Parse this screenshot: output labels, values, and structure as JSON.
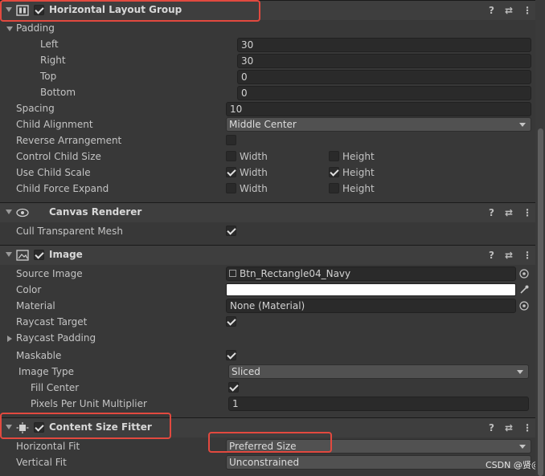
{
  "horizontal_layout_group": {
    "title": "Horizontal Layout Group",
    "enabled": true,
    "padding_label": "Padding",
    "left_label": "Left",
    "left_value": "30",
    "right_label": "Right",
    "right_value": "30",
    "top_label": "Top",
    "top_value": "0",
    "bottom_label": "Bottom",
    "bottom_value": "0",
    "spacing_label": "Spacing",
    "spacing_value": "10",
    "child_alignment_label": "Child Alignment",
    "child_alignment_value": "Middle Center",
    "reverse_arrangement_label": "Reverse Arrangement",
    "reverse_arrangement": false,
    "control_child_size_label": "Control Child Size",
    "use_child_scale_label": "Use Child Scale",
    "child_force_expand_label": "Child Force Expand",
    "width_label": "Width",
    "height_label": "Height",
    "control_child_size": {
      "width": false,
      "height": false
    },
    "use_child_scale": {
      "width": true,
      "height": true
    },
    "child_force_expand": {
      "width": false,
      "height": false
    }
  },
  "canvas_renderer": {
    "title": "Canvas Renderer",
    "cull_label": "Cull Transparent Mesh",
    "cull": true
  },
  "image": {
    "title": "Image",
    "enabled": true,
    "source_image_label": "Source Image",
    "source_image_value": "Btn_Rectangle04_Navy",
    "color_label": "Color",
    "color_value": "#ffffff",
    "material_label": "Material",
    "material_value": "None (Material)",
    "raycast_target_label": "Raycast Target",
    "raycast_target": true,
    "raycast_padding_label": "Raycast Padding",
    "maskable_label": "Maskable",
    "maskable": true,
    "image_type_label": "Image Type",
    "image_type_value": "Sliced",
    "fill_center_label": "Fill Center",
    "fill_center": true,
    "ppu_label": "Pixels Per Unit Multiplier",
    "ppu_value": "1"
  },
  "content_size_fitter": {
    "title": "Content Size Fitter",
    "enabled": true,
    "horizontal_fit_label": "Horizontal Fit",
    "horizontal_fit_value": "Preferred Size",
    "vertical_fit_label": "Vertical Fit",
    "vertical_fit_value": "Unconstrained"
  },
  "header_icons": {
    "help": "?",
    "settings": "⇄",
    "more": "⋮"
  },
  "watermark": "CSDN @贤@",
  "colors": {
    "highlight": "#e2493f",
    "panel": "#383838",
    "header": "#3e3e3e",
    "field": "#2a2a2a"
  }
}
